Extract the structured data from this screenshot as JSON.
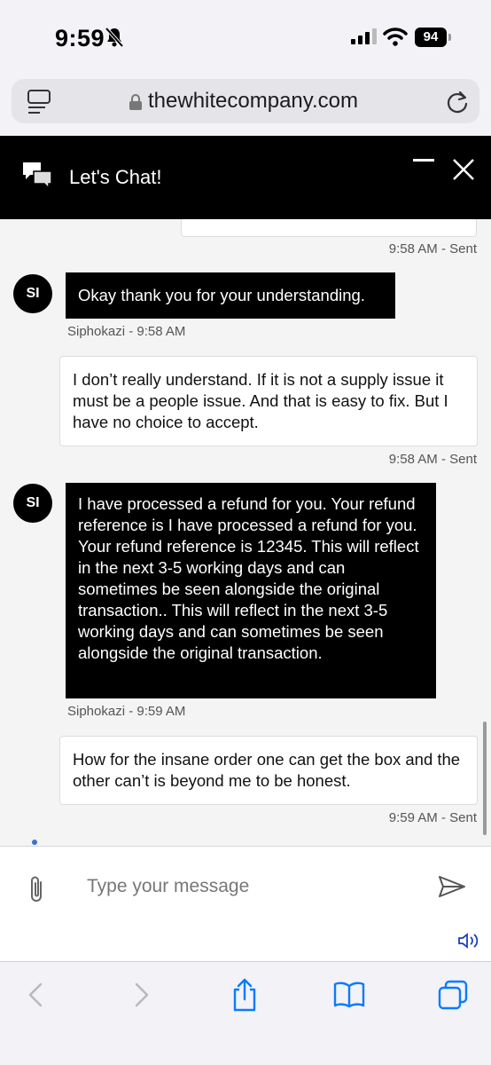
{
  "status_bar": {
    "time": "9:59",
    "battery": "94"
  },
  "browser": {
    "url": "thewhitecompany.com"
  },
  "chat": {
    "title": "Let's Chat!",
    "messages": [
      {
        "meta": "9:58 AM - Sent"
      },
      {
        "avatar": "SI",
        "text": "Okay thank you for your understanding.",
        "meta": "Siphokazi - 9:58 AM"
      },
      {
        "text": "I don’t really understand. If it is not a supply issue it must be a people issue. And that is easy to fix. But I have no choice to accept.",
        "meta": "9:58 AM - Sent"
      },
      {
        "avatar": "SI",
        "text": "I have processed a refund for you. Your refund reference is I have processed a refund for you. Your refund reference is 12345. This will reflect in the next 3-5 working days and can sometimes be seen alongside the original transaction.. This will reflect in the next 3-5 working days and can sometimes be seen alongside the original transaction.",
        "meta": "Siphokazi - 9:59 AM"
      },
      {
        "text": "How for the insane order one can get the box and the other can’t is beyond me to be honest.",
        "meta": "9:59 AM - Sent"
      }
    ],
    "input_placeholder": "Type your message"
  },
  "icons": {
    "status": [
      "bell-slash-icon",
      "signal-icon",
      "wifi-icon",
      "battery-icon"
    ],
    "browser": [
      "reader-icon",
      "lock-icon",
      "reload-icon"
    ],
    "chat": [
      "chat-bubbles-icon",
      "minimize-icon",
      "close-icon",
      "paperclip-icon",
      "send-icon",
      "speaker-icon"
    ],
    "toolbar": [
      "back-icon",
      "forward-icon",
      "share-icon",
      "bookmarks-icon",
      "tabs-icon"
    ]
  },
  "colors": {
    "accent": "#0a7aff",
    "chat_header": "#000000",
    "agent_bubble": "#000000",
    "user_bubble": "#ffffff"
  }
}
